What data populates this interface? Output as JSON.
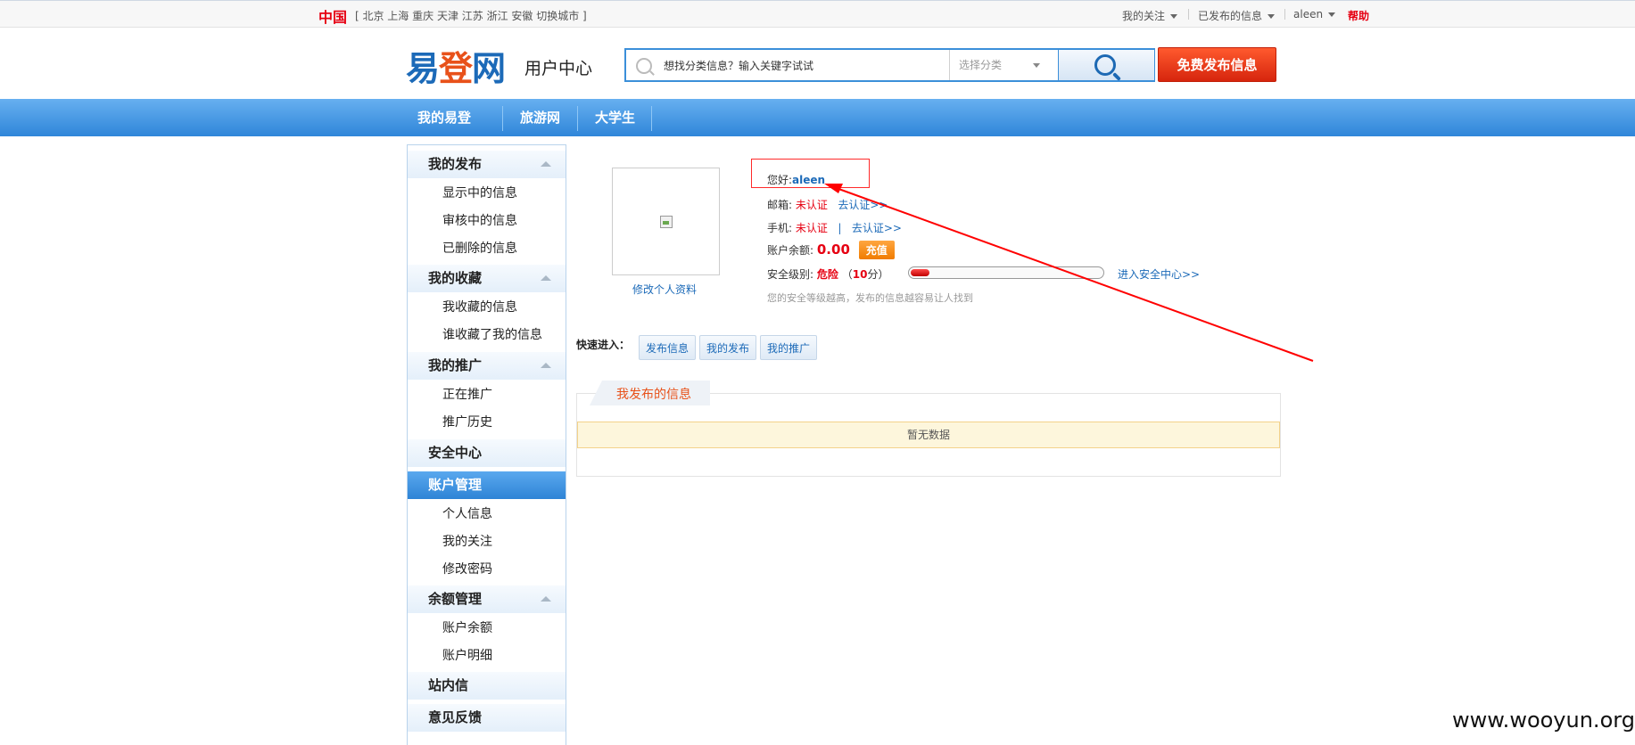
{
  "topbar": {
    "country": "中国",
    "cities": "[ 北京 上海 重庆 天津 江苏 浙江 安徽 切换城市 ]",
    "my_follow": "我的关注",
    "published": "已发布的信息",
    "user": "aleen",
    "help": "帮助"
  },
  "header": {
    "logo_part1": "易",
    "logo_part2": "登",
    "logo_part3": "网",
    "user_center": "用户中心",
    "search_placeholder": "想找分类信息？输入关键字试试",
    "category": "选择分类",
    "post_button": "免费发布信息"
  },
  "nav": {
    "items": [
      "我的易登",
      "旅游网",
      "大学生"
    ]
  },
  "sidebar": {
    "groups": [
      {
        "title": "我的发布",
        "items": [
          "显示中的信息",
          "审核中的信息",
          "已删除的信息"
        ]
      },
      {
        "title": "我的收藏",
        "items": [
          "我收藏的信息",
          "谁收藏了我的信息"
        ]
      },
      {
        "title": "我的推广",
        "items": [
          "正在推广",
          "推广历史"
        ]
      },
      {
        "title": "安全中心",
        "items": []
      },
      {
        "title": "账户管理",
        "items": [
          "个人信息",
          "我的关注",
          "修改密码"
        ]
      },
      {
        "title": "余额管理",
        "items": [
          "账户余额",
          "账户明细"
        ]
      },
      {
        "title": "站内信",
        "items": []
      },
      {
        "title": "意见反馈",
        "items": []
      }
    ]
  },
  "profile": {
    "edit_link": "修改个人资料",
    "hello_label": "您好:",
    "username": "aleen",
    "email_label": "邮箱:",
    "email_status": "未认证",
    "email_action": "去认证>>",
    "phone_label": "手机:",
    "phone_status": "未认证",
    "phone_sep": "|",
    "phone_action": "去认证>>",
    "balance_label": "账户余额:",
    "balance": "0.00",
    "recharge": "充值",
    "security_label": "安全级别:",
    "security_level": "危险",
    "security_score_open": "（",
    "security_score": "10",
    "security_score_close": "分）",
    "security_progress": 0.1,
    "security_link": "进入安全中心>>",
    "tip": "您的安全等级越高，发布的信息越容易让人找到"
  },
  "quick": {
    "label": "快速进入：",
    "buttons": [
      "发布信息",
      "我的发布",
      "我的推广"
    ]
  },
  "posts": {
    "tab": "我发布的信息",
    "empty": "暂无数据"
  },
  "watermark": "www.wooyun.org",
  "colors": {
    "brand_blue": "#1c6ab8",
    "brand_orange": "#e8511a",
    "alert_red": "#e60012",
    "nav_blue": "#2f86d9"
  }
}
